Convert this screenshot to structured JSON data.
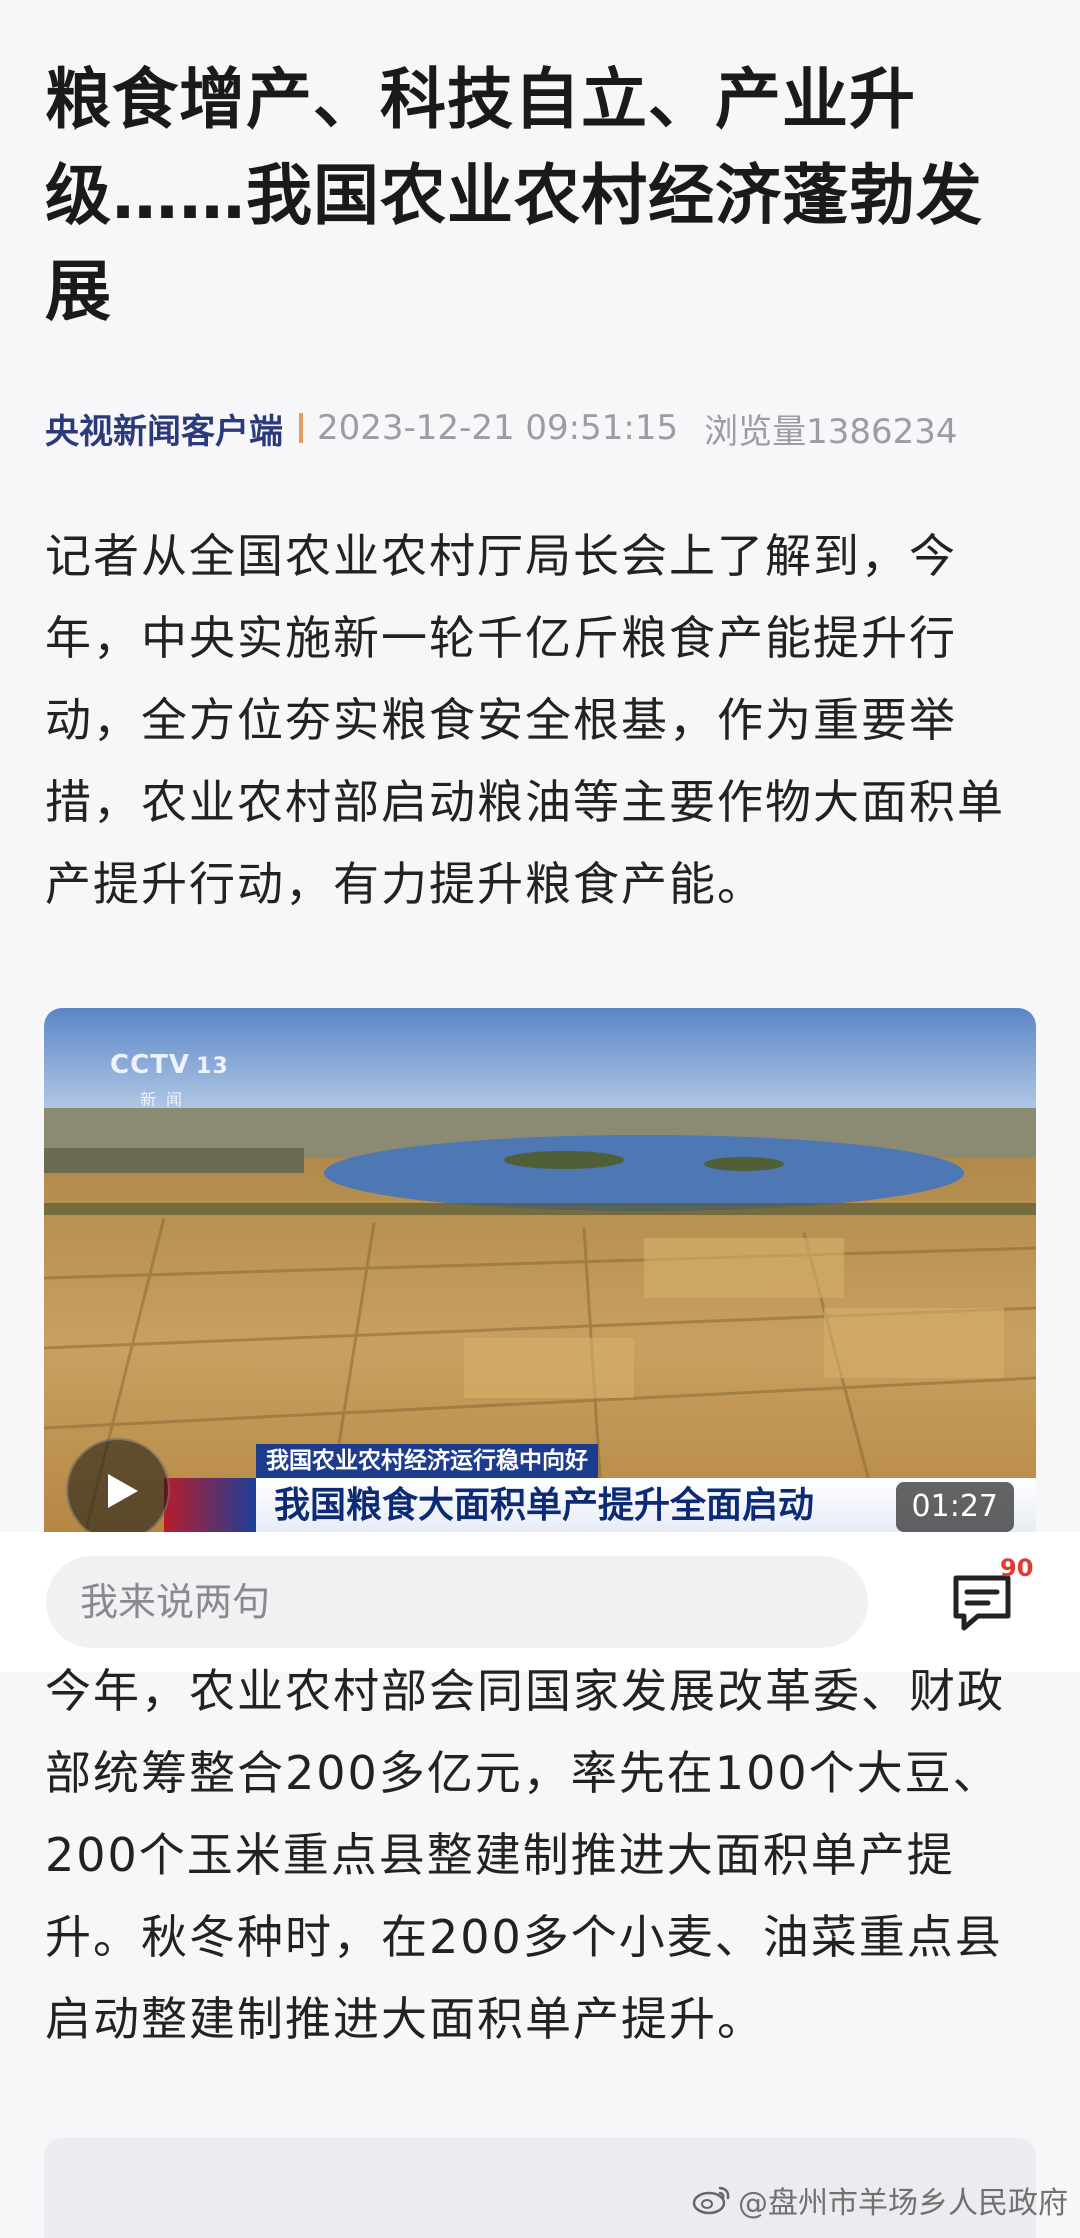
{
  "article": {
    "title": "粮食增产、科技自立、产业升级……我国农业农村经济蓬勃发展",
    "source": "央视新闻客户端",
    "datetime": "2023-12-21 09:51:15",
    "views": "浏览量1386234",
    "paragraphs": [
      "记者从全国农业农村厅局长会上了解到，今年，中央实施新一轮千亿斤粮食产能提升行动，全方位夯实粮食安全根基，作为重要举措，农业农村部启动粮油等主要作物大面积单产提升行动，有力提升粮食产能。",
      "今年，农业农村部会同国家发展改革委、财政部统筹整合200多亿元，率先在100个大豆、200个玉米重点县整建制推进大面积单产提升。秋冬种时，在200多个小麦、油菜重点县启动整建制推进大面积单产提升。"
    ]
  },
  "video": {
    "channel_logo": "CCTV",
    "channel_number": "13",
    "channel_sub": "新闻",
    "banner_top": "我国农业农村经济运行稳中向好",
    "banner_main": "我国粮食大面积单产提升全面启动",
    "duration": "01:27"
  },
  "comment_bar": {
    "placeholder": "我来说两句",
    "comment_count": "90"
  },
  "watermark": "@盘州市羊场乡人民政府",
  "colors": {
    "source": "#2b3a7a",
    "separator": "#e0a063",
    "badge": "#e23a33"
  }
}
